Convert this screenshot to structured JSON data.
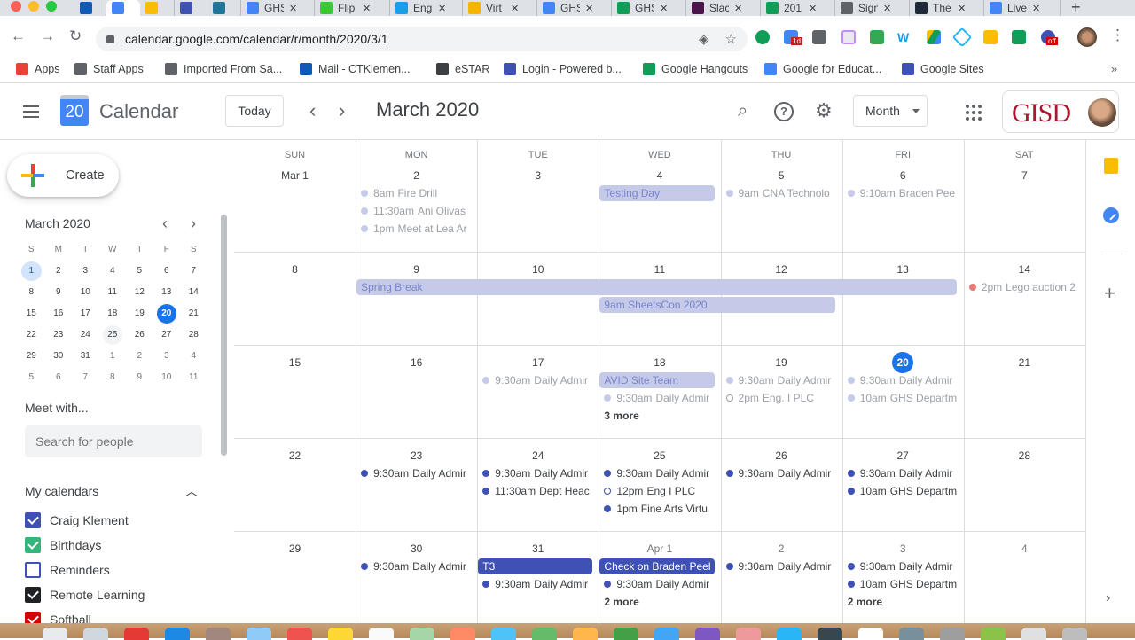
{
  "browser": {
    "tabs": [
      {
        "title": "",
        "icon": "outlook-icon",
        "color": "#0f5ab8"
      },
      {
        "title": "",
        "icon": "calendar-icon",
        "color": "#4285f4",
        "active": true
      },
      {
        "title": "",
        "icon": "drive-icon",
        "color": "#fbbc04"
      },
      {
        "title": "",
        "icon": "sites-icon",
        "color": "#3f51b5"
      },
      {
        "title": "",
        "icon": "wordpress-icon",
        "color": "#21759b"
      },
      {
        "title": "GHS",
        "icon": "docs-icon",
        "color": "#4285f4"
      },
      {
        "title": "Flip",
        "icon": "flipgrid-icon",
        "color": "#38c935"
      },
      {
        "title": "Eng",
        "icon": "pin-icon",
        "color": "#1a9ee8"
      },
      {
        "title": "Virt",
        "icon": "slides-icon",
        "color": "#f4b400"
      },
      {
        "title": "GHS",
        "icon": "docs-icon",
        "color": "#4285f4"
      },
      {
        "title": "GHS",
        "icon": "sheets-icon",
        "color": "#0f9d58"
      },
      {
        "title": "Slack",
        "icon": "slack-icon",
        "color": "#4a154b"
      },
      {
        "title": "201",
        "icon": "sheets-icon",
        "color": "#0f9d58"
      },
      {
        "title": "Sign",
        "icon": "globe-icon",
        "color": "#5f6368"
      },
      {
        "title": "The",
        "icon": "script-s-icon",
        "color": "#1e2a3a"
      },
      {
        "title": "Live",
        "icon": "google-icon",
        "color": "#4285f4"
      }
    ],
    "url": "calendar.google.com/calendar/r/month/2020/3/1",
    "bookmarks": [
      {
        "label": "Apps",
        "icon": "apps-grid-icon",
        "color": "#ea4335"
      },
      {
        "label": "Staff Apps",
        "icon": "folder-icon",
        "color": "#5f6368"
      },
      {
        "label": "Imported From Sa...",
        "icon": "folder-icon",
        "color": "#5f6368"
      },
      {
        "label": "Mail - CTKlemen...",
        "icon": "outlook-icon",
        "color": "#0f5ab8"
      },
      {
        "label": "eSTAR",
        "icon": "globe-icon",
        "color": "#3c4043"
      },
      {
        "label": "Login - Powered b...",
        "icon": "sky-icon",
        "color": "#3f51b5"
      },
      {
        "label": "Google Hangouts",
        "icon": "hangouts-icon",
        "color": "#0f9d58"
      },
      {
        "label": "Google for Educat...",
        "icon": "classroom-icon",
        "color": "#4285f4"
      },
      {
        "label": "Google Sites",
        "icon": "sites-icon",
        "color": "#3f51b5"
      }
    ],
    "ext_badges": {
      "calendar_badge": "1d",
      "off_badge": "off"
    }
  },
  "header": {
    "app_title": "Calendar",
    "logo_day": "20",
    "today_label": "Today",
    "current_period": "March 2020",
    "view_label": "Month",
    "org_logo": "GISD"
  },
  "sidebar": {
    "create_label": "Create",
    "mini_title": "March 2020",
    "mini_dow": [
      "S",
      "M",
      "T",
      "W",
      "T",
      "F",
      "S"
    ],
    "mini_days": [
      [
        "1",
        "2",
        "3",
        "4",
        "5",
        "6",
        "7"
      ],
      [
        "8",
        "9",
        "10",
        "11",
        "12",
        "13",
        "14"
      ],
      [
        "15",
        "16",
        "17",
        "18",
        "19",
        "20",
        "21"
      ],
      [
        "22",
        "23",
        "24",
        "25",
        "26",
        "27",
        "28"
      ],
      [
        "29",
        "30",
        "31",
        "1",
        "2",
        "3",
        "4"
      ],
      [
        "5",
        "6",
        "7",
        "8",
        "9",
        "10",
        "11"
      ]
    ],
    "meet_title": "Meet with...",
    "search_placeholder": "Search for people",
    "my_calendars_title": "My calendars",
    "calendars": [
      {
        "name": "Craig Klement",
        "checked": true,
        "color": "#3f51b5"
      },
      {
        "name": "Birthdays",
        "checked": true,
        "color": "#33b679"
      },
      {
        "name": "Reminders",
        "checked": false,
        "color": "#3f51b5"
      },
      {
        "name": "Remote Learning",
        "checked": true,
        "color": "#202124"
      },
      {
        "name": "Softball",
        "checked": true,
        "color": "#d50000"
      }
    ]
  },
  "month": {
    "dow": [
      "SUN",
      "MON",
      "TUE",
      "WED",
      "THU",
      "FRI",
      "SAT"
    ],
    "weeks": [
      [
        {
          "label": "Mar 1"
        },
        {
          "label": "2",
          "events": [
            {
              "time": "8am",
              "title": "Fire Drill",
              "state": "past"
            },
            {
              "time": "11:30am",
              "title": "Ani Olivas",
              "state": "past"
            },
            {
              "time": "1pm",
              "title": "Meet at Lea Ar",
              "state": "past"
            }
          ]
        },
        {
          "label": "3"
        },
        {
          "label": "4",
          "bars": [
            {
              "title": "Testing Day",
              "state": "past"
            }
          ]
        },
        {
          "label": "5",
          "events": [
            {
              "time": "9am",
              "title": "CNA Technolo",
              "state": "past"
            }
          ]
        },
        {
          "label": "6",
          "events": [
            {
              "time": "9:10am",
              "title": "Braden Pee",
              "state": "past"
            }
          ]
        },
        {
          "label": "7"
        }
      ],
      [
        {
          "label": "8"
        },
        {
          "label": "9"
        },
        {
          "label": "10"
        },
        {
          "label": "11"
        },
        {
          "label": "12"
        },
        {
          "label": "13"
        },
        {
          "label": "14",
          "events": [
            {
              "time": "2pm",
              "title": "Lego auction 2",
              "state": "past",
              "color": "#e67c73"
            }
          ]
        }
      ],
      [
        {
          "label": "15"
        },
        {
          "label": "16"
        },
        {
          "label": "17",
          "events": [
            {
              "time": "9:30am",
              "title": "Daily Admir",
              "state": "past"
            }
          ]
        },
        {
          "label": "18",
          "bars": [
            {
              "title": "AVID Site Team",
              "state": "past"
            }
          ],
          "events": [
            {
              "time": "9:30am",
              "title": "Daily Admir",
              "state": "past"
            }
          ],
          "more": "3 more"
        },
        {
          "label": "19",
          "events": [
            {
              "time": "9:30am",
              "title": "Daily Admir",
              "state": "past"
            },
            {
              "time": "2pm",
              "title": "Eng. I PLC",
              "state": "past",
              "hollow": true
            }
          ]
        },
        {
          "label": "20",
          "today": true,
          "events": [
            {
              "time": "9:30am",
              "title": "Daily Admir",
              "state": "past"
            },
            {
              "time": "10am",
              "title": "GHS Departm",
              "state": "past"
            }
          ]
        },
        {
          "label": "21"
        }
      ],
      [
        {
          "label": "22"
        },
        {
          "label": "23",
          "events": [
            {
              "time": "9:30am",
              "title": "Daily Admir",
              "state": "future"
            }
          ]
        },
        {
          "label": "24",
          "events": [
            {
              "time": "9:30am",
              "title": "Daily Admir",
              "state": "future"
            },
            {
              "time": "11:30am",
              "title": "Dept Heac",
              "state": "future"
            }
          ]
        },
        {
          "label": "25",
          "events": [
            {
              "time": "9:30am",
              "title": "Daily Admir",
              "state": "future"
            },
            {
              "time": "12pm",
              "title": "Eng I PLC",
              "state": "future",
              "hollow": true
            },
            {
              "time": "1pm",
              "title": "Fine Arts Virtu",
              "state": "future"
            }
          ]
        },
        {
          "label": "26",
          "events": [
            {
              "time": "9:30am",
              "title": "Daily Admir",
              "state": "future"
            }
          ]
        },
        {
          "label": "27",
          "events": [
            {
              "time": "9:30am",
              "title": "Daily Admir",
              "state": "future"
            },
            {
              "time": "10am",
              "title": "GHS Departm",
              "state": "future"
            }
          ]
        },
        {
          "label": "28"
        }
      ],
      [
        {
          "label": "29"
        },
        {
          "label": "30",
          "events": [
            {
              "time": "9:30am",
              "title": "Daily Admir",
              "state": "future"
            }
          ]
        },
        {
          "label": "31",
          "bars": [
            {
              "title": "T3",
              "state": "future"
            }
          ],
          "events": [
            {
              "time": "9:30am",
              "title": "Daily Admir",
              "state": "future"
            }
          ]
        },
        {
          "label": "Apr 1",
          "other": true,
          "bars": [
            {
              "title": "Check on Braden Peel",
              "state": "future"
            }
          ],
          "events": [
            {
              "time": "9:30am",
              "title": "Daily Admir",
              "state": "future"
            }
          ],
          "more": "2 more"
        },
        {
          "label": "2",
          "other": true,
          "events": [
            {
              "time": "9:30am",
              "title": "Daily Admir",
              "state": "future"
            }
          ]
        },
        {
          "label": "3",
          "other": true,
          "events": [
            {
              "time": "9:30am",
              "title": "Daily Admir",
              "state": "future"
            },
            {
              "time": "10am",
              "title": "GHS Departm",
              "state": "future"
            }
          ],
          "more": "2 more"
        },
        {
          "label": "4",
          "other": true
        }
      ]
    ],
    "spanning": [
      {
        "title": "Spring Break",
        "week": 1,
        "start": 1,
        "end": 5,
        "state": "past"
      },
      {
        "title": "9am SheetsCon 2020",
        "week": 1,
        "start": 3,
        "end": 4,
        "state": "past",
        "row": 1
      }
    ],
    "colors": {
      "past_dot": "#c5cae9",
      "future_dot": "#3f51b5",
      "today": "#1a73e8"
    }
  }
}
